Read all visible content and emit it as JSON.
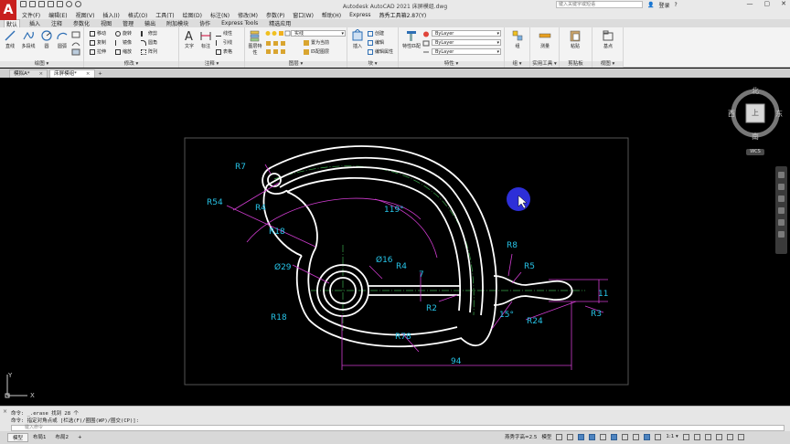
{
  "app": {
    "logo": "A",
    "title": "Autodesk AutoCAD 2021    床屏模组.dwg",
    "search_placeholder": "键入关键字或短语",
    "user_label": "登录",
    "help": "?",
    "window_controls": [
      "—",
      "▢",
      "✕"
    ]
  },
  "menu": [
    "文件(F)",
    "编辑(E)",
    "视图(V)",
    "插入(I)",
    "格式(O)",
    "工具(T)",
    "绘图(D)",
    "标注(N)",
    "修改(M)",
    "参数(P)",
    "窗口(W)",
    "帮助(H)",
    "Express",
    "燕秀工具箱2.87(Y)"
  ],
  "ribbon_tabs": [
    "默认",
    "插入",
    "注释",
    "参数化",
    "视图",
    "管理",
    "输出",
    "附加模块",
    "协作",
    "Express Tools",
    "精选应用"
  ],
  "ribbon": {
    "draw": {
      "title": "绘图 ▾",
      "tools": [
        "直线",
        "多段线",
        "圆",
        "圆弧"
      ]
    },
    "modify": {
      "title": "修改 ▾",
      "tools": [
        "移动",
        "旋转",
        "修剪",
        "复制",
        "镜像",
        "圆角",
        "拉伸",
        "缩放",
        "阵列"
      ]
    },
    "annotation": {
      "title": "注释 ▾",
      "tools": [
        "文字",
        "标注",
        "线性",
        "引线",
        "表格"
      ]
    },
    "layers": {
      "title": "图层 ▾",
      "tools": [
        "图层特性",
        "置为当前",
        "匹配图层"
      ],
      "layer_name": "实线"
    },
    "block": {
      "title": "块 ▾",
      "tools": [
        "插入",
        "创建",
        "编辑",
        "编辑属性"
      ]
    },
    "properties": {
      "title": "特性 ▾",
      "tools": [
        "特性匹配"
      ],
      "combos": [
        "ByLayer",
        "ByLayer",
        "ByLayer"
      ]
    },
    "groups": {
      "title": "组 ▾",
      "tools": [
        "组"
      ]
    },
    "utilities": {
      "title": "实用工具 ▾",
      "tools": [
        "测量"
      ]
    },
    "clipboard": {
      "title": "剪贴板",
      "tools": [
        "粘贴"
      ]
    },
    "view": {
      "title": "视图 ▾",
      "tools": [
        "基点"
      ]
    }
  },
  "doc_tabs": [
    {
      "label": "模拟A*",
      "active": false
    },
    {
      "label": "床屏模组*",
      "active": true
    }
  ],
  "viewcube": {
    "north": "北",
    "south": "南",
    "east": "东",
    "west": "西",
    "top": "上",
    "wcs": "WCS"
  },
  "ucs": {
    "x": "X",
    "y": "Y"
  },
  "drawing": {
    "dimensions": [
      "R7",
      "R54",
      "R4",
      "R18",
      "119°",
      "Ø29",
      "Ø16",
      "R4",
      "7",
      "R18",
      "R2",
      "R8",
      "R5",
      "15°",
      "R78",
      "R24",
      "R3",
      "11",
      "94"
    ]
  },
  "command": {
    "line1": "命令: _.erase 找到 28 个",
    "line2": "命令: 指定对角点或 [栏选(F)/圈围(WP)/圈交(CP)]:",
    "input_placeholder": "键入命令"
  },
  "status": {
    "tabs": [
      "模型",
      "布局1",
      "布局2"
    ],
    "plus": "+",
    "right_label": "燕秀字高=2.5",
    "model_label": "模型",
    "scale": "1:1 ▾"
  }
}
